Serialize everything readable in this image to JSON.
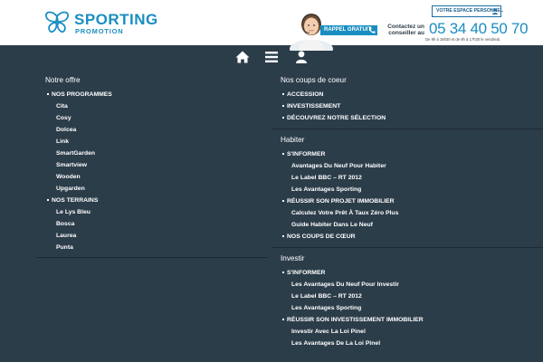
{
  "header": {
    "logo_brand": "SPORTING",
    "logo_sub": "PROMOTION",
    "espace_button": "VOTRE ESPACE PERSONNEL",
    "rappel_button": "RAPPEL GRATUIT",
    "contact_label": "Contactez un conseiller au",
    "phone": "05 34 40 50 70",
    "hours": "De 9h à 18h30 et de 9h à 17h30 le vendredi."
  },
  "toolbar": {
    "icons": [
      "home-icon",
      "menu-icon",
      "user-icon"
    ]
  },
  "left": {
    "title": "Notre offre",
    "groups": [
      {
        "label": "NOS PROGRAMMES",
        "items": [
          "Cita",
          "Cosy",
          "Dolcea",
          "Link",
          "SmartGarden",
          "Smartview",
          "Wooden",
          "Upgarden"
        ]
      },
      {
        "label": "NOS TERRAINS",
        "items": [
          "Le Lys Bleu",
          "Bosca",
          "Laurea",
          "Punta"
        ]
      }
    ]
  },
  "right": {
    "sections": [
      {
        "title": "Nos coups de coeur",
        "groups": [
          {
            "label": "ACCESSION",
            "items": []
          },
          {
            "label": "INVESTISSEMENT",
            "items": []
          },
          {
            "label": "DÉCOUVREZ NOTRE SÉLECTION",
            "items": []
          }
        ]
      },
      {
        "title": "Habiter",
        "groups": [
          {
            "label": "S'INFORMER",
            "items": [
              "Avantages Du Neuf Pour Habiter",
              "Le Label BBC – RT 2012",
              "Les Avantages Sporting"
            ]
          },
          {
            "label": "RÉUSSIR SON PROJET IMMOBILIER",
            "items": [
              "Calculez Votre Prêt À Taux Zéro Plus",
              "Guide Habiter Dans Le Neuf"
            ]
          },
          {
            "label": "NOS COUPS DE CŒUR",
            "items": []
          }
        ]
      },
      {
        "title": "Investir",
        "groups": [
          {
            "label": "S'INFORMER",
            "items": [
              "Les Avantages Du Neuf Pour Investir",
              "Le Label BBC – RT 2012",
              "Les Avantages Sporting"
            ]
          },
          {
            "label": "RÉUSSIR SON INVESTISSEMENT IMMOBILIER",
            "items": [
              "Investir Avec La Loi Pinel",
              "Les Avantages De La Loi Pinel"
            ]
          }
        ]
      }
    ]
  },
  "colors": {
    "background": "#2c3d4a",
    "accent": "#1a8ec1",
    "divider": "#1d2a33",
    "text": "#ffffff"
  }
}
